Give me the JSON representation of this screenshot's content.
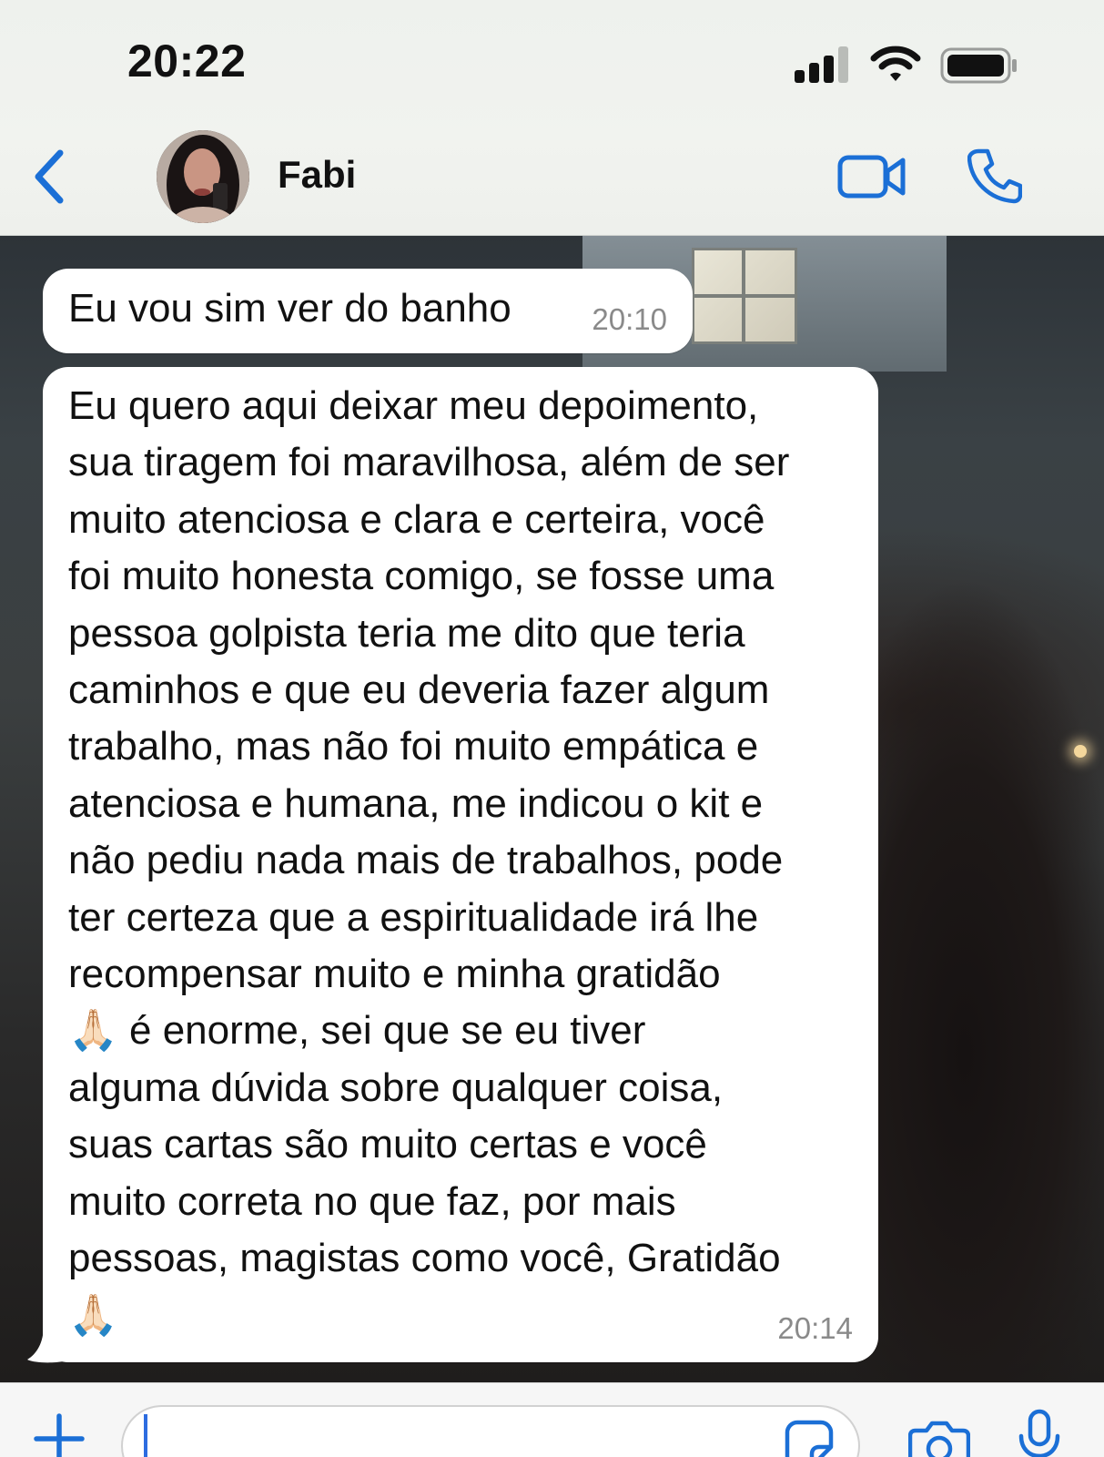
{
  "status_bar": {
    "time": "20:22"
  },
  "header": {
    "contact_name": "Fabi",
    "icons": [
      "back-chevron-icon",
      "video-camera-icon",
      "phone-icon"
    ]
  },
  "messages": [
    {
      "text": "Eu vou sim ver do banho",
      "time": "20:10"
    },
    {
      "text": "Eu quero aqui deixar meu depoimento,\nsua tiragem foi maravilhosa, além de ser\nmuito atenciosa e clara e certeira, você\nfoi muito honesta comigo, se fosse uma\npessoa golpista teria me dito que teria\ncaminhos e que eu deveria fazer algum\ntrabalho, mas não foi muito empática e\natenciosa e humana, me indicou o kit e\nnão pediu nada mais de trabalhos, pode\nter certeza que a espiritualidade irá lhe\nrecompensar muito e minha gratidão\n🙏🏻 é enorme, sei que se eu tiver\nalguma dúvida sobre qualquer coisa,\nsuas cartas são muito certas e você\nmuito correta no que faz, por mais\npessoas, magistas como você, Gratidão\n🙏🏻",
      "time": "20:14"
    }
  ],
  "input_bar": {
    "value": "",
    "placeholder": "",
    "icons": [
      "plus-icon",
      "sticker-icon",
      "camera-icon",
      "microphone-icon"
    ]
  },
  "colors": {
    "accent": "#1b6fd6",
    "bubble": "#ffffff",
    "timestamp": "#8a8a8a"
  }
}
